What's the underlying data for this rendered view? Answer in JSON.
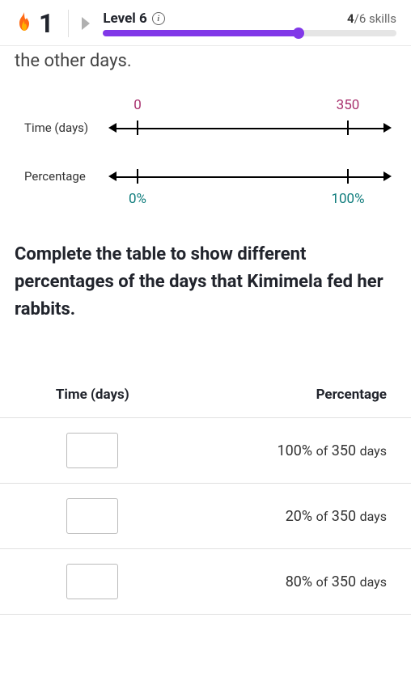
{
  "header": {
    "streak": "1",
    "level_label": "Level 6",
    "skills_current": "4",
    "skills_total": "/6 skills",
    "progress_percent": 66.6
  },
  "prev_text": "the other days.",
  "diagram": {
    "rows": [
      {
        "label": "Time (days)",
        "start": "0",
        "end": "350",
        "position": "top"
      },
      {
        "label": "Percentage",
        "start": "0%",
        "end": "100%",
        "position": "bottom"
      }
    ]
  },
  "prompt": "Complete the table to show different percentages of the days that Kimimela fed her rabbits.",
  "table": {
    "headers": {
      "time": "Time (days)",
      "pct": "Percentage"
    },
    "rows": [
      {
        "pct": "100%",
        "of": "of",
        "total": "350",
        "unit": "days",
        "input": ""
      },
      {
        "pct": "20%",
        "of": "of",
        "total": "350",
        "unit": "days",
        "input": ""
      },
      {
        "pct": "80%",
        "of": "of",
        "total": "350",
        "unit": "days",
        "input": ""
      }
    ]
  }
}
